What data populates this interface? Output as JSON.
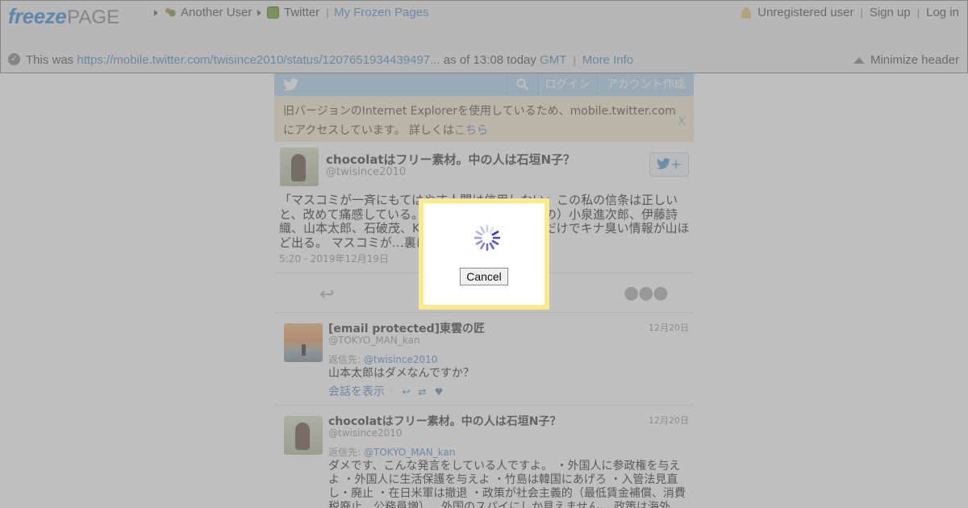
{
  "freezepage": {
    "logo_freeze": "freeze",
    "logo_page": "PAGE",
    "breadcrumb": {
      "another_user": "Another User",
      "twitter": "Twitter",
      "separator": "|",
      "my_frozen_pages": "My Frozen Pages"
    },
    "account": {
      "unregistered": "Unregistered user",
      "sign_up": "Sign up",
      "log_in": "Log in",
      "separator": "|"
    },
    "info": {
      "prefix": "This was ",
      "url": "https://mobile.twitter.com/twisince2010/status/1207651934439497...",
      "as_of": " as of 13:08 today ",
      "timezone": "GMT",
      "separator": "|",
      "more_info": "More Info"
    },
    "minimize": "Minimize header"
  },
  "twitter": {
    "nav": {
      "login": "ログイン",
      "signup": "アカウント作成"
    },
    "notice": {
      "text": "旧バージョンのInternet Explorerを使用しているため、mobile.twitter.comにアクセスしています。 詳しくは",
      "link": "こちら",
      "close": "X"
    },
    "main_tweet": {
      "name": "chocolatはフリー素材。中の人は石垣N子？",
      "handle": "@twisince2010",
      "body": "「マスコミが一斉にもてはやす人間は信用しない」この私の信条は正しいと、改めて痛感している。グレタ…（中略：石垣の）小泉進次郎、伊藤詩織、山本太郎、石破茂、KuToo…ちょっと調べるだけでキナ臭い情報が山ほど出る。 マスコミが…裏にウラがある。",
      "time": "5:20 - 2019年12月19日",
      "follow_label": "+"
    },
    "replies": [
      {
        "name": "[email protected]東雲の匠",
        "handle": "@TOKYO_MAN_kan",
        "date": "12月20日",
        "reply_to_label": "返信先: ",
        "reply_to": "@twisince2010",
        "body": "山本太郎はダメなんですか？",
        "show_conversation": "会話を表示"
      },
      {
        "name": "chocolatはフリー素材。中の人は石垣N子？",
        "handle": "@twisince2010",
        "date": "12月20日",
        "reply_to_label": "返信先: ",
        "reply_to": "@TOKYO_MAN_kan",
        "body": "ダメです、こんな発言をしている人ですよ。 ・外国人に参政権を与えよ ・外国人に生活保護を与えよ ・竹島は韓国にあげろ ・入管法見直し・廃止 ・在日米軍は撤退 ・政策が社会主義的（最低賃金補償、消費税廃止、公務員増）…外国のスパイにしか見えません。 政策は海外"
      }
    ]
  },
  "dialog": {
    "cancel": "Cancel"
  },
  "colors": {
    "overlay": "#808080",
    "dialog_border": "#fae98a",
    "freeze_blue": "#3d8fd6",
    "link_blue": "#5b8ec4",
    "twitter_bar": "#b6d4ef",
    "notice_bg": "#f7ebcf"
  },
  "icons": {
    "spinner": "loading-spinner-icon",
    "bird": "twitter-bird-icon",
    "search": "search-icon",
    "reply": "reply-icon",
    "retweet": "retweet-icon",
    "like": "heart-icon",
    "more": "more-dots-icon",
    "minimize": "triangle-up-icon",
    "check": "check-circle-icon",
    "user": "user-icon"
  }
}
